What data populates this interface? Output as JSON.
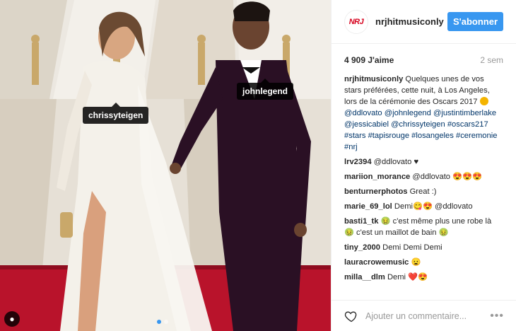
{
  "post": {
    "photo_tags": [
      "chrissyteigen",
      "johnlegend"
    ],
    "account": "nrjhitmusiconly",
    "logo_text": "NRJ",
    "follow_label": "S'abonner",
    "likes": "4 909 J'aime",
    "age": "2 sem",
    "caption": {
      "user": "nrjhitmusiconly",
      "text": "Quelques unes de vos stars préférées, cette nuit, à Los Angeles, lors de la cérémonie des Oscars 2017",
      "mentions": "@ddlovato @johnlegend @justintimberlake @jessicabiel @chrissyteigen #oscars217 #stars #tapisrouge #losangeles #ceremonie #nrj"
    },
    "comments": [
      {
        "user": "lrv2394",
        "text": "@ddlovato ♥"
      },
      {
        "user": "mariion_morance",
        "text": "@ddlovato 😍😍😍"
      },
      {
        "user": "benturnerphotos",
        "text": "Great :)"
      },
      {
        "user": "marie_69_lol",
        "text": "Demi😋😍 @ddlovato"
      },
      {
        "user": "basti1_tk",
        "text": "🤢 c'est même plus une robe là 🤢 c'est un maillot de bain 🤢"
      },
      {
        "user": "tiny_2000",
        "text": "Demi Demi Demi"
      },
      {
        "user": "lauracrowemusic",
        "text": "😦"
      },
      {
        "user": "milla__dlm",
        "text": "Demi ❤️😍"
      }
    ],
    "comment_placeholder": "Ajouter un commentaire...",
    "icons": {
      "like": "heart-icon",
      "more": "more-icon"
    },
    "colors": {
      "accent": "#3897f0",
      "carpet": "#b9132b"
    }
  }
}
